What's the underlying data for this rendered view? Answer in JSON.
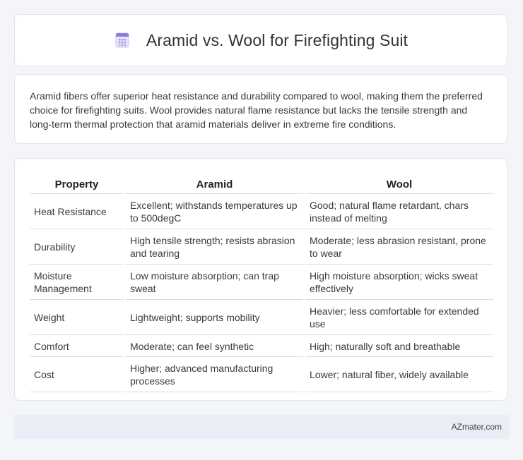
{
  "header": {
    "icon": "spreadsheet-icon",
    "title": "Aramid vs. Wool for Firefighting Suit"
  },
  "intro": {
    "text": "Aramid fibers offer superior heat resistance and durability compared to wool, making them the preferred choice for firefighting suits. Wool provides natural flame resistance but lacks the tensile strength and long-term thermal protection that aramid materials deliver in extreme fire conditions."
  },
  "table": {
    "headers": [
      "Property",
      "Aramid",
      "Wool"
    ],
    "rows": [
      [
        "Heat Resistance",
        "Excellent; withstands temperatures up to 500degC",
        "Good; natural flame retardant, chars instead of melting"
      ],
      [
        "Durability",
        "High tensile strength; resists abrasion and tearing",
        "Moderate; less abrasion resistant, prone to wear"
      ],
      [
        "Moisture Management",
        "Low moisture absorption; can trap sweat",
        "High moisture absorption; wicks sweat effectively"
      ],
      [
        "Weight",
        "Lightweight; supports mobility",
        "Heavier; less comfortable for extended use"
      ],
      [
        "Comfort",
        "Moderate; can feel synthetic",
        "High; naturally soft and breathable"
      ],
      [
        "Cost",
        "Higher; advanced manufacturing processes",
        "Lower; natural fiber, widely available"
      ]
    ]
  },
  "footer": {
    "source": "AZmater.com"
  },
  "colors": {
    "background": "#f4f5f8",
    "card": "#ffffff",
    "footer": "#e8edf6",
    "icon_accent": "#8a7fd8"
  }
}
